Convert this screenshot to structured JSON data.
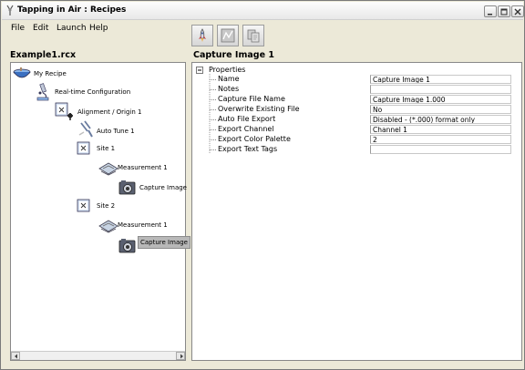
{
  "window": {
    "title": "Tapping in Air : Recipes"
  },
  "menu": [
    "File",
    "Edit",
    "Launch",
    "Help"
  ],
  "toolbar": {
    "icons": [
      "rocket-icon",
      "chart-icon",
      "copy-icon"
    ]
  },
  "left_panel": {
    "title": "Example1.rcx",
    "tree": [
      {
        "label": "My Recipe",
        "icon": "recipe-bowl-icon"
      },
      {
        "label": "Real-time Configuration",
        "icon": "microscope-icon"
      },
      {
        "label": "Alignment / Origin 1",
        "icon": "alignment-icon"
      },
      {
        "label": "Auto Tune 1",
        "icon": "tuning-fork-icon"
      },
      {
        "label": "Site 1",
        "icon": "site-icon"
      },
      {
        "label": "Measurement 1",
        "icon": "measurement-icon"
      },
      {
        "label": "Capture Image",
        "icon": "camera-icon"
      },
      {
        "label": "Site 2",
        "icon": "site-icon"
      },
      {
        "label": "Measurement 1",
        "icon": "measurement-icon"
      },
      {
        "label": "Capture Image",
        "icon": "camera-icon",
        "selected": true
      }
    ]
  },
  "right_panel": {
    "title": "Capture Image 1",
    "root_label": "Properties",
    "properties": [
      {
        "name": "Name",
        "value": "Capture Image 1"
      },
      {
        "name": "Notes",
        "value": ""
      },
      {
        "name": "Capture File Name",
        "value": "Capture Image 1.000"
      },
      {
        "name": "Overwrite Existing File",
        "value": "No"
      },
      {
        "name": "Auto File Export",
        "value": "Disabled - (*.000) format only"
      },
      {
        "name": "Export Channel",
        "value": "Channel 1"
      },
      {
        "name": "Export Color Palette",
        "value": "2"
      },
      {
        "name": "Export Text Tags",
        "value": ""
      }
    ]
  }
}
